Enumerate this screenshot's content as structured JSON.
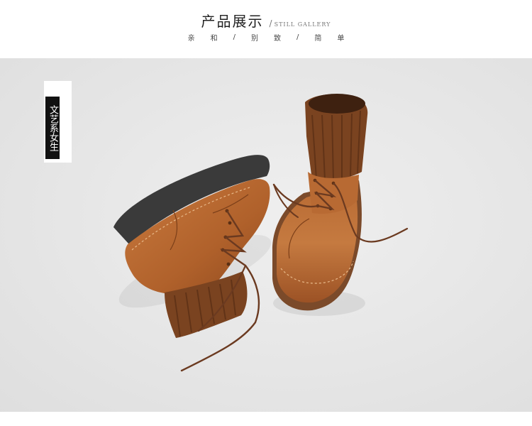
{
  "header": {
    "title_cn": "产品展示",
    "separator": "/",
    "title_en": "STILL GALLERY",
    "subtitle": [
      "亲",
      "和",
      "/",
      "别",
      "致",
      "/",
      "简",
      "单"
    ]
  },
  "tag": {
    "text": "文艺系女生"
  },
  "photo": {
    "subject": "brown-leather-ankle-boots-icon",
    "colors": {
      "background": "#e7e7e7",
      "leather": "#b4652e",
      "knit": "#7a4320",
      "sole": "#3b3b3b",
      "lace": "#6b3a20"
    }
  }
}
